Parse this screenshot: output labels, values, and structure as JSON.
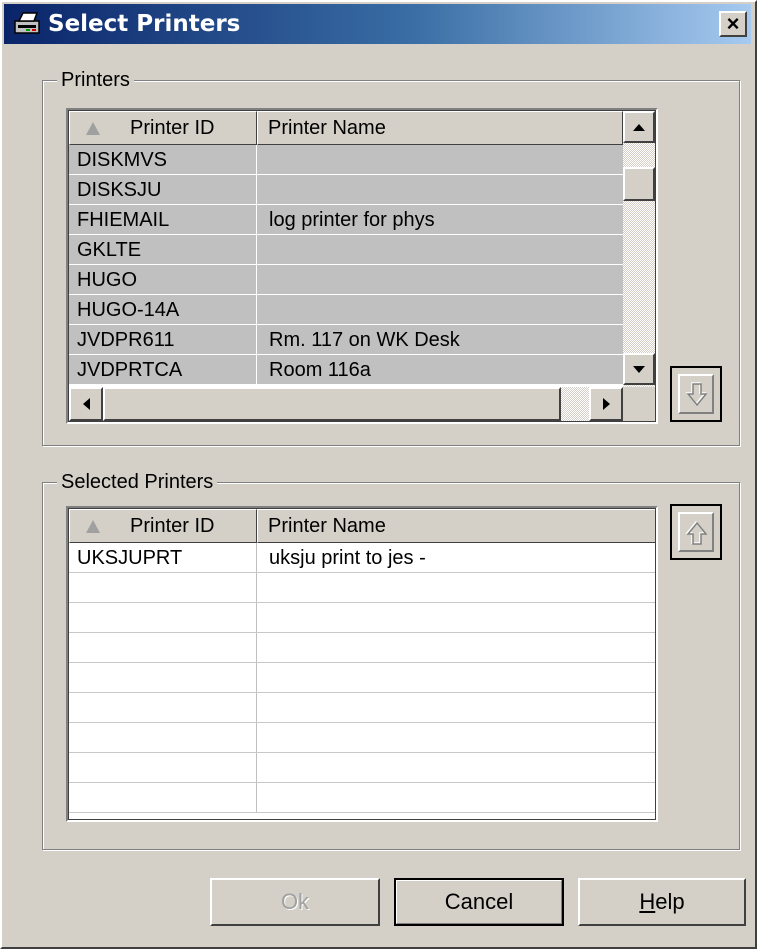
{
  "window": {
    "title": "Select Printers",
    "close_label": "×",
    "icon": "printer-icon"
  },
  "printers_group": {
    "label": "Printers",
    "columns": [
      "Printer ID",
      "Printer Name"
    ],
    "rows": [
      {
        "id": "DISKMVS",
        "name": ""
      },
      {
        "id": "DISKSJU",
        "name": ""
      },
      {
        "id": "FHIEMAIL",
        "name": "log printer for phys"
      },
      {
        "id": "GKLTE",
        "name": ""
      },
      {
        "id": "HUGO",
        "name": ""
      },
      {
        "id": "HUGO-14A",
        "name": ""
      },
      {
        "id": "JVDPR611",
        "name": "Rm. 117 on WK Desk"
      },
      {
        "id": "JVDPRTCA",
        "name": "Room 116a"
      }
    ]
  },
  "selected_group": {
    "label": "Selected Printers",
    "columns": [
      "Printer ID",
      "Printer Name"
    ],
    "rows": [
      {
        "id": "UKSJUPRT",
        "name": "uksju print to jes -"
      },
      {
        "id": "",
        "name": ""
      },
      {
        "id": "",
        "name": ""
      },
      {
        "id": "",
        "name": ""
      },
      {
        "id": "",
        "name": ""
      },
      {
        "id": "",
        "name": ""
      },
      {
        "id": "",
        "name": ""
      },
      {
        "id": "",
        "name": ""
      },
      {
        "id": "",
        "name": ""
      }
    ]
  },
  "buttons": {
    "ok": "Ok",
    "cancel": "Cancel",
    "help_first": "H",
    "help_rest": "elp"
  },
  "colors": {
    "title_start": "#0a246a",
    "title_end": "#a6caf0",
    "face": "#d4d0c8",
    "row_gray": "#c0c0c0"
  }
}
